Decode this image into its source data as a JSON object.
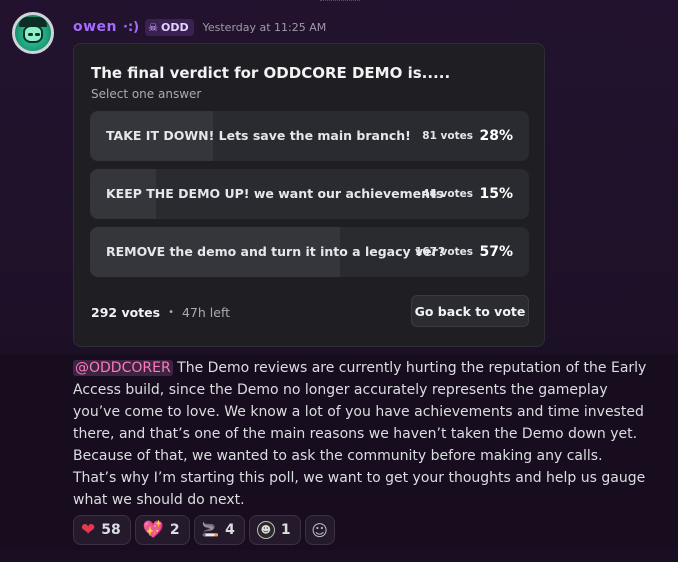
{
  "author": {
    "name": "owen",
    "name_deco": "·:)",
    "tag": "ODD",
    "tag_icon": "skull-icon",
    "timestamp": "Yesterday at 11:25 AM"
  },
  "poll": {
    "question": "The final verdict for ODDCORE DEMO is.....",
    "subtitle": "Select one answer",
    "answers": [
      {
        "label": "TAKE IT DOWN! Lets save the main branch!",
        "votes": "81 votes",
        "percent": "28%",
        "fraction": 0.28
      },
      {
        "label": "KEEP THE DEMO UP! we want our achievements",
        "votes": "44 votes",
        "percent": "15%",
        "fraction": 0.15
      },
      {
        "label": "REMOVE the demo and turn it into a legacy ver?",
        "votes": "167 votes",
        "percent": "57%",
        "fraction": 0.57
      }
    ],
    "total_votes": "292 votes",
    "separator": "•",
    "time_left": "47h left",
    "vote_button": "Go back to vote"
  },
  "message": {
    "mention": "@ODDCORER",
    "paragraph1": " The Demo reviews are currently hurting the reputation of the Early Access build, since the Demo no longer accurately represents the gameplay you’ve come to love. We know a lot of you have achievements and time invested there, and that’s one of the main reasons we haven’t taken the Demo down yet. Because of that, we wanted to ask the community before making any calls.",
    "paragraph2": "That’s why I’m starting this poll, we want to get your thoughts and help us gauge what we should do next."
  },
  "reactions": [
    {
      "emoji": "❤",
      "icon": "red-heart-icon",
      "count": "58"
    },
    {
      "emoji": "💖",
      "icon": "sparkling-heart-icon",
      "count": "2"
    },
    {
      "emoji": "🚬",
      "icon": "cigarette-icon",
      "count": "4"
    },
    {
      "emoji": "☻",
      "icon": "custom-face-icon",
      "count": "1"
    }
  ],
  "colors": {
    "username": "#a46bff",
    "mention": "#ff79b5",
    "background": "#1e1129"
  }
}
